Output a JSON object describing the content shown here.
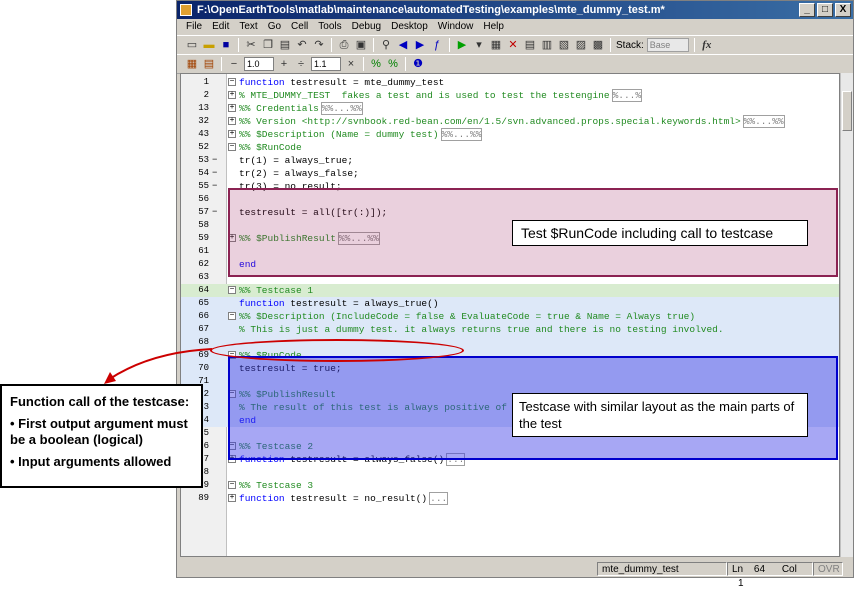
{
  "window": {
    "title": "F:\\OpenEarthTools\\matlab\\maintenance\\automatedTesting\\examples\\mte_dummy_test.m*",
    "controls": {
      "minimize": "_",
      "maximize": "□",
      "close": "X"
    }
  },
  "menu": [
    "File",
    "Edit",
    "Text",
    "Go",
    "Cell",
    "Tools",
    "Debug",
    "Desktop",
    "Window",
    "Help"
  ],
  "toolbar": {
    "stack_label": "Stack:",
    "stack_value": "Base",
    "fx_label": "fx",
    "minus": "−",
    "plus": "+",
    "divide": "÷",
    "times": "×",
    "increment_value": "1.0",
    "divisor_value": "1.1"
  },
  "code_lines": [
    {
      "num": "1",
      "dash": "",
      "fold": "−",
      "text": "function testresult = mte_dummy_test",
      "style": "kw",
      "hl": ""
    },
    {
      "num": "2",
      "dash": "",
      "fold": "+",
      "text": "% MTE_DUMMY_TEST  fakes a test and is used to test the testengine",
      "style": "cm",
      "more": "%...%",
      "hl": ""
    },
    {
      "num": "13",
      "dash": "",
      "fold": "+",
      "text": "%% Credentials",
      "style": "cm",
      "more": "%%...%%",
      "hl": ""
    },
    {
      "num": "32",
      "dash": "",
      "fold": "+",
      "text": "%% Version <http://svnbook.red-bean.com/en/1.5/svn.advanced.props.special.keywords.html>",
      "style": "cm",
      "more": "%%...%%",
      "hl": ""
    },
    {
      "num": "43",
      "dash": "",
      "fold": "+",
      "text": "%% $Description (Name = dummy test)",
      "style": "cm",
      "more": "%%...%%",
      "hl": ""
    },
    {
      "num": "52",
      "dash": "",
      "fold": "−",
      "text": "%% $RunCode",
      "style": "cm",
      "hl": ""
    },
    {
      "num": "53",
      "dash": "−",
      "fold": "",
      "text": "tr(1) = always_true;",
      "style": "",
      "hl": ""
    },
    {
      "num": "54",
      "dash": "−",
      "fold": "",
      "text": "tr(2) = always_false;",
      "style": "",
      "hl": ""
    },
    {
      "num": "55",
      "dash": "−",
      "fold": "",
      "text": "tr(3) = no_result;",
      "style": "",
      "hl": ""
    },
    {
      "num": "56",
      "dash": "",
      "fold": "",
      "text": "",
      "style": "",
      "hl": ""
    },
    {
      "num": "57",
      "dash": "−",
      "fold": "",
      "text": "testresult = all([tr(:)]);",
      "style": "",
      "hl": ""
    },
    {
      "num": "58",
      "dash": "",
      "fold": "",
      "text": "",
      "style": "",
      "hl": ""
    },
    {
      "num": "59",
      "dash": "",
      "fold": "+",
      "text": "%% $PublishResult",
      "style": "cm",
      "more": "%%...%%",
      "hl": ""
    },
    {
      "num": "61",
      "dash": "",
      "fold": "",
      "text": "",
      "style": "",
      "hl": ""
    },
    {
      "num": "62",
      "dash": "",
      "fold": "",
      "text": "end",
      "style": "kw",
      "hl": ""
    },
    {
      "num": "63",
      "dash": "",
      "fold": "",
      "text": "",
      "style": "",
      "hl": ""
    },
    {
      "num": "64",
      "dash": "",
      "fold": "−",
      "text": "%% Testcase 1",
      "style": "cm",
      "hl": "green"
    },
    {
      "num": "65",
      "dash": "",
      "fold": "",
      "text": "function testresult = always_true()",
      "style": "kw",
      "hl": "blue"
    },
    {
      "num": "66",
      "dash": "",
      "fold": "−",
      "text": "%% $Description (IncludeCode = false & EvaluateCode = true & Name = Always true)",
      "style": "cm",
      "hl": "blue"
    },
    {
      "num": "67",
      "dash": "",
      "fold": "",
      "text": "% This is just a dummy test. it always returns true and there is no testing involved.",
      "style": "cm",
      "hl": "blue"
    },
    {
      "num": "68",
      "dash": "",
      "fold": "",
      "text": "",
      "style": "",
      "hl": "blue"
    },
    {
      "num": "69",
      "dash": "",
      "fold": "−",
      "text": "%% $RunCode",
      "style": "cm",
      "hl": "blue"
    },
    {
      "num": "70",
      "dash": "",
      "fold": "",
      "text": "testresult = true;",
      "style": "",
      "hl": "blue"
    },
    {
      "num": "71",
      "dash": "",
      "fold": "",
      "text": "",
      "style": "",
      "hl": "blue"
    },
    {
      "num": "72",
      "dash": "",
      "fold": "−",
      "text": "%% $PublishResult",
      "style": "cm",
      "hl": "blue"
    },
    {
      "num": "73",
      "dash": "",
      "fold": "",
      "text": "% The result of this test is always positive of course, whereas it does not really test anything.",
      "style": "cm",
      "hl": "blue"
    },
    {
      "num": "74",
      "dash": "",
      "fold": "",
      "text": "end",
      "style": "kw",
      "hl": "blue"
    },
    {
      "num": "75",
      "dash": "",
      "fold": "",
      "text": "",
      "style": "",
      "hl": ""
    },
    {
      "num": "76",
      "dash": "",
      "fold": "−",
      "text": "%% Testcase 2",
      "style": "cm",
      "hl": ""
    },
    {
      "num": "77",
      "dash": "",
      "fold": "+",
      "text": "function testresult = always_false()",
      "style": "kw",
      "more": "...",
      "hl": ""
    },
    {
      "num": "88",
      "dash": "",
      "fold": "",
      "text": "",
      "style": "",
      "hl": ""
    },
    {
      "num": "89",
      "dash": "",
      "fold": "−",
      "text": "%% Testcase 3",
      "style": "cm",
      "hl": ""
    },
    {
      "num": "89",
      "dash": "",
      "fold": "+",
      "text": "function testresult = no_result()",
      "style": "kw",
      "more": "...",
      "hl": ""
    }
  ],
  "status": {
    "file": "mte_dummy_test",
    "ln_label": "Ln",
    "ln_value": "64",
    "col_label": "Col",
    "col_value": "1",
    "mode": "OVR"
  },
  "annotations": {
    "runcode": "Test $RunCode including call to testcase",
    "testcase": "Testcase with similar layout as the main parts of the test",
    "function_call": {
      "heading": "Function call of the testcase:",
      "bullet1": "• First output argument must be a boolean (logical)",
      "bullet2": "• Input arguments allowed"
    }
  },
  "colors": {
    "runcode_box": "#8b2252",
    "testcase_box": "#0000cc",
    "ellipse": "#cc0000"
  }
}
